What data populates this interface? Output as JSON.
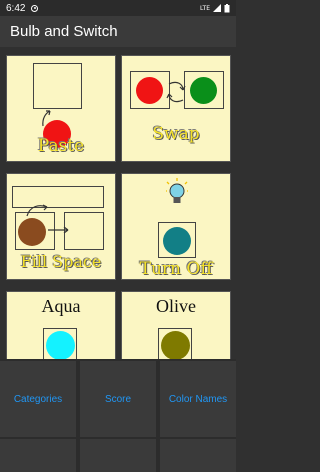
{
  "status": {
    "time": "6:42",
    "network": "LTE"
  },
  "appbar": {
    "title": "Bulb and Switch"
  },
  "tiles": [
    {
      "caption": "Paste"
    },
    {
      "caption": "Swap"
    },
    {
      "caption": "Fill Space"
    },
    {
      "caption": "Turn Off"
    },
    {
      "caption": "Aqua"
    },
    {
      "caption": "Olive"
    }
  ],
  "bottom_nav": {
    "categories_label": "Categories",
    "score_label": "Score",
    "color_names_label": "Color Names"
  },
  "colors": {
    "tile_bg": "#fbf6c3",
    "red": "#f01414",
    "green": "#0a8f1a",
    "brown": "#8a4b1f",
    "teal": "#127f86",
    "aqua": "#14f2ff",
    "olive": "#7f7a00",
    "caption_yellow": "#f4e12a",
    "link_blue": "#2196f3"
  }
}
